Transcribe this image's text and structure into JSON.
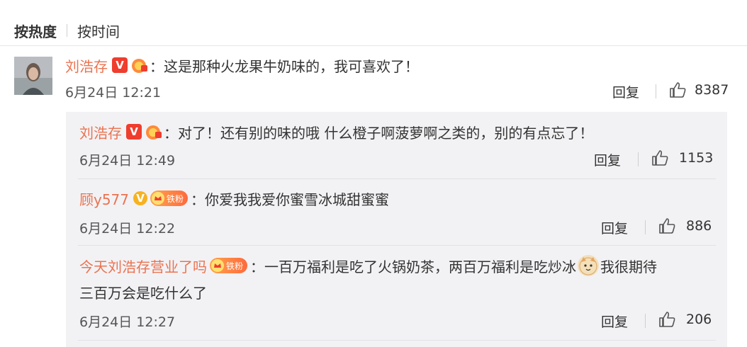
{
  "sort": {
    "active": "按热度",
    "other": "按时间"
  },
  "comment": {
    "username": "刘浩存",
    "text": "：这是那种火龙果牛奶味的，我可喜欢了！",
    "time": "6月24日 12:21",
    "reply_label": "回复",
    "likes": "8387"
  },
  "replies": [
    {
      "username": "刘浩存",
      "text": "：对了！还有别的味的哦 什么橙子啊菠萝啊之类的，别的有点忘了！",
      "time": "6月24日 12:49",
      "reply_label": "回复",
      "likes": "1153"
    },
    {
      "username": "顾y577",
      "badge_text": "铁粉",
      "text": "：你爱我我爱你蜜雪冰城甜蜜蜜",
      "time": "6月24日 12:22",
      "reply_label": "回复",
      "likes": "886"
    },
    {
      "username": "今天刘浩存营业了吗",
      "badge_text": "铁粉",
      "text_part1": "：一百万福利是吃了火锅奶茶，两百万福利是吃炒冰",
      "text_part2": "我很期待",
      "text_line2": "三百万会是吃什么了",
      "time": "6月24日 12:27",
      "reply_label": "回复",
      "likes": "206"
    }
  ],
  "colors": {
    "username": "#eb7350",
    "panel_bg": "#f2f2f5"
  }
}
